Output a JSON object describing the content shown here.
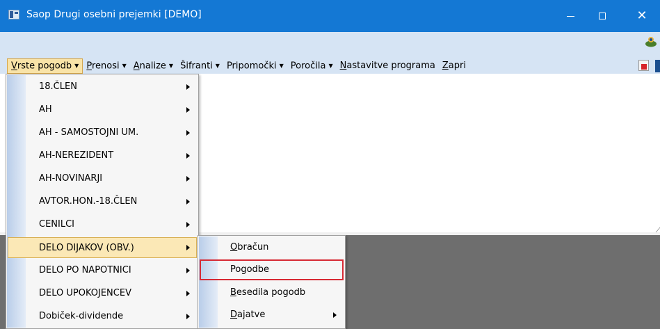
{
  "window": {
    "title": "Saop Drugi osebni prejemki [DEMO]",
    "controls": {
      "minimize": "—",
      "maximize": "☐",
      "close": "✕"
    }
  },
  "menubar": {
    "items": [
      {
        "label": "Vrste pogodb",
        "accel": "V",
        "rest": "rste pogodb",
        "has_caret": true
      },
      {
        "label": "Prenosi",
        "accel": "P",
        "rest": "renosi",
        "has_caret": true
      },
      {
        "label": "Analize",
        "accel": "A",
        "rest": "nalize",
        "has_caret": true
      },
      {
        "label": "Šifranti",
        "accel": "",
        "rest": "Šifranti",
        "has_caret": true
      },
      {
        "label": "Pripomočki",
        "accel": "",
        "rest": "Pripomočki",
        "has_caret": true
      },
      {
        "label": "Poročila",
        "accel": "",
        "rest": "Poročila",
        "has_caret": true
      },
      {
        "label": "Nastavitve programa",
        "accel": "N",
        "rest": "astavitve programa",
        "has_caret": false
      },
      {
        "label": "Zapri",
        "accel": "Z",
        "rest": "apri",
        "has_caret": false
      }
    ],
    "caret": "▼"
  },
  "contract_menu": {
    "items": [
      {
        "label": "18.ČLEN",
        "submenu": true
      },
      {
        "label": "AH",
        "submenu": true
      },
      {
        "label": "AH - SAMOSTOJNI UM.",
        "submenu": true
      },
      {
        "label": "AH-NEREZIDENT",
        "submenu": true
      },
      {
        "label": "AH-NOVINARJI",
        "submenu": true
      },
      {
        "label": "AVTOR.HON.-18.ČLEN",
        "submenu": true
      },
      {
        "label": "CENILCI",
        "submenu": true
      },
      {
        "label": "DELO DIJAKOV (OBV.)",
        "submenu": true,
        "highlighted": true
      },
      {
        "label": "DELO PO NAPOTNICI",
        "submenu": true
      },
      {
        "label": "DELO UPOKOJENCEV",
        "submenu": true
      },
      {
        "label": "Dobiček-dividende",
        "submenu": true
      }
    ]
  },
  "sub_menu": {
    "items": [
      {
        "accel": "O",
        "rest": "bračun",
        "label": "Obračun",
        "submenu": false
      },
      {
        "accel": "",
        "rest": "Pogodbe",
        "label": "Pogodbe",
        "submenu": false,
        "boxed": true
      },
      {
        "accel": "B",
        "rest": "esedila pogodb",
        "label": "Besedila pogodb",
        "submenu": false
      },
      {
        "accel": "D",
        "rest": "ajatve",
        "label": "Dajatve",
        "submenu": true
      }
    ]
  },
  "colors": {
    "titlebar": "#1478d4",
    "menubar": "#d6e4f4",
    "highlight": "#fbe8b6",
    "annotation_box": "#d72a34",
    "workspace_dark": "#6e6e6e"
  }
}
